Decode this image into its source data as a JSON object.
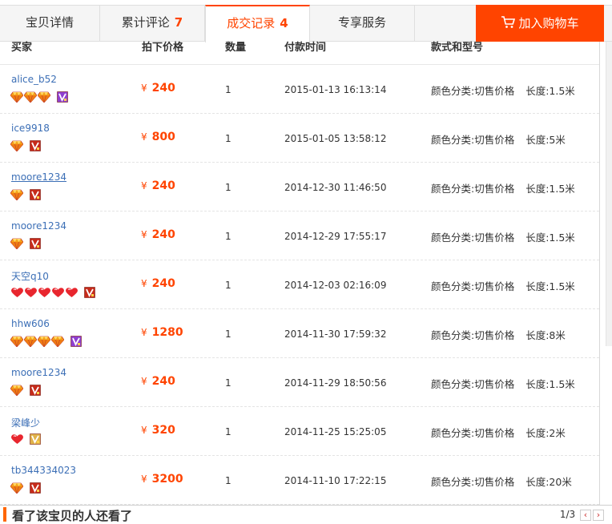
{
  "tabs": [
    {
      "label": "宝贝详情",
      "count": ""
    },
    {
      "label": "累计评论",
      "count": "7"
    },
    {
      "label": "成交记录",
      "count": "4"
    },
    {
      "label": "专享服务",
      "count": ""
    }
  ],
  "active_tab": 2,
  "cart_button": {
    "label": "加入购物车",
    "icon": "cart-icon"
  },
  "table": {
    "headers": {
      "buyer": "买家",
      "price": "拍下价格",
      "qty": "数量",
      "time": "付款时间",
      "spec": "款式和型号"
    },
    "currency": "¥",
    "rows": [
      {
        "buyer": "alice_b52",
        "badge_type": "gem",
        "badge_count": 3,
        "vip": "purple",
        "price": "240",
        "qty": "1",
        "time": "2015-01-13 16:13:14",
        "color": "颜色分类:切售价格",
        "length": "长度:1.5米"
      },
      {
        "buyer": "ice9918",
        "badge_type": "gem",
        "badge_count": 1,
        "vip": "red",
        "price": "800",
        "qty": "1",
        "time": "2015-01-05 13:58:12",
        "color": "颜色分类:切售价格",
        "length": "长度:5米"
      },
      {
        "buyer": "moore1234",
        "badge_type": "gem",
        "badge_count": 1,
        "vip": "red",
        "price": "240",
        "qty": "1",
        "time": "2014-12-30 11:46:50",
        "color": "颜色分类:切售价格",
        "length": "长度:1.5米"
      },
      {
        "buyer": "moore1234",
        "badge_type": "gem",
        "badge_count": 1,
        "vip": "red",
        "price": "240",
        "qty": "1",
        "time": "2014-12-29 17:55:17",
        "color": "颜色分类:切售价格",
        "length": "长度:1.5米"
      },
      {
        "buyer": "天空q10",
        "badge_type": "heart",
        "badge_count": 5,
        "vip": "red",
        "price": "240",
        "qty": "1",
        "time": "2014-12-03 02:16:09",
        "color": "颜色分类:切售价格",
        "length": "长度:1.5米"
      },
      {
        "buyer": "hhw606",
        "badge_type": "gem",
        "badge_count": 4,
        "vip": "purple",
        "price": "1280",
        "qty": "1",
        "time": "2014-11-30 17:59:32",
        "color": "颜色分类:切售价格",
        "length": "长度:8米"
      },
      {
        "buyer": "moore1234",
        "badge_type": "gem",
        "badge_count": 1,
        "vip": "red",
        "price": "240",
        "qty": "1",
        "time": "2014-11-29 18:50:56",
        "color": "颜色分类:切售价格",
        "length": "长度:1.5米"
      },
      {
        "buyer": "梁峰少",
        "badge_type": "heart",
        "badge_count": 1,
        "vip": "gold",
        "price": "320",
        "qty": "1",
        "time": "2014-11-25 15:25:05",
        "color": "颜色分类:切售价格",
        "length": "长度:2米"
      },
      {
        "buyer": "tb344334023",
        "badge_type": "gem",
        "badge_count": 1,
        "vip": "red",
        "price": "3200",
        "qty": "1",
        "time": "2014-11-10 17:22:15",
        "color": "颜色分类:切售价格",
        "length": "长度:20米"
      }
    ]
  },
  "footer": {
    "title": "看了该宝贝的人还看了",
    "pager_text": "1/3",
    "prev_icon": "chevron-left-icon",
    "next_icon": "chevron-right-icon",
    "prev_label": "‹",
    "next_label": "›"
  },
  "colors": {
    "accent": "#ff4400",
    "link": "#3c6fb6",
    "price": "#ff4400"
  }
}
